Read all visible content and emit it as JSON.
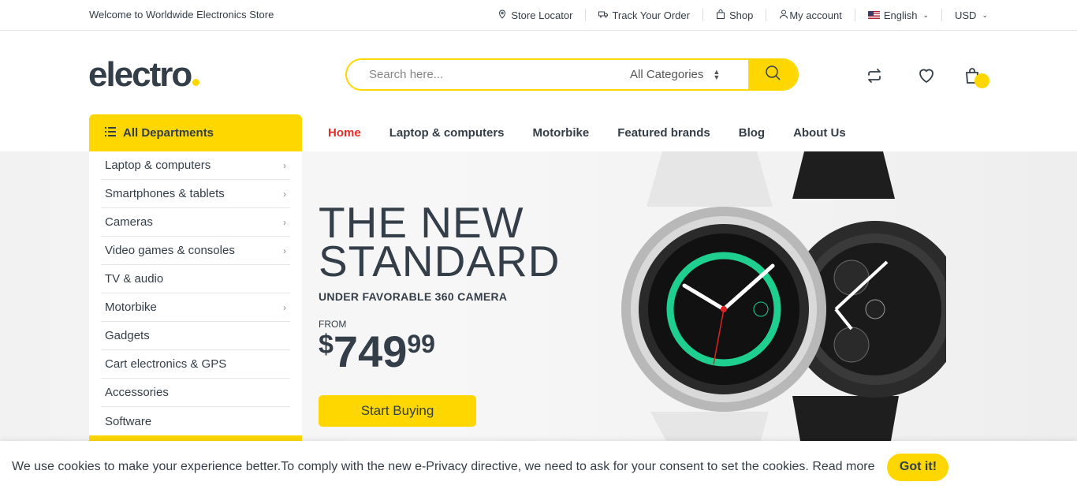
{
  "topbar": {
    "welcome": "Welcome to Worldwide Electronics Store",
    "links": {
      "store_locator": "Store Locator",
      "track_order": "Track Your Order",
      "shop": "Shop",
      "my_account": "My account",
      "language": "English",
      "currency": "USD"
    }
  },
  "header": {
    "logo": "electro",
    "search_placeholder": "Search here...",
    "category_select": "All Categories",
    "icons": [
      "compare-icon",
      "heart-icon",
      "shopping-bag-icon"
    ]
  },
  "nav": {
    "departments_label": "All Departments",
    "items": [
      "Home",
      "Laptop & computers",
      "Motorbike",
      "Featured brands",
      "Blog",
      "About Us"
    ],
    "active": "Home"
  },
  "sidebar": {
    "items": [
      {
        "label": "Laptop & computers",
        "has_submenu": true
      },
      {
        "label": "Smartphones & tablets",
        "has_submenu": true
      },
      {
        "label": "Cameras",
        "has_submenu": true
      },
      {
        "label": "Video games & consoles",
        "has_submenu": true
      },
      {
        "label": "TV & audio",
        "has_submenu": false
      },
      {
        "label": "Motorbike",
        "has_submenu": true
      },
      {
        "label": "Gadgets",
        "has_submenu": false
      },
      {
        "label": "Cart electronics & GPS",
        "has_submenu": false
      },
      {
        "label": "Accessories",
        "has_submenu": false
      },
      {
        "label": "Software",
        "has_submenu": false
      }
    ]
  },
  "hero": {
    "title_line1": "THE NEW",
    "title_line2": "STANDARD",
    "subtitle": "UNDER FAVORABLE 360 CAMERA",
    "from_label": "FROM",
    "price_currency": "$",
    "price_int": "749",
    "price_dec": "99",
    "cta": "Start Buying"
  },
  "cookie": {
    "message": "We use cookies to make your experience better.To comply with the new e-Privacy directive, we need to ask for your consent to set the cookies. Read more",
    "button": "Got it!"
  },
  "colors": {
    "accent": "#fed700",
    "text": "#333e48",
    "active_nav": "#e52d27"
  }
}
